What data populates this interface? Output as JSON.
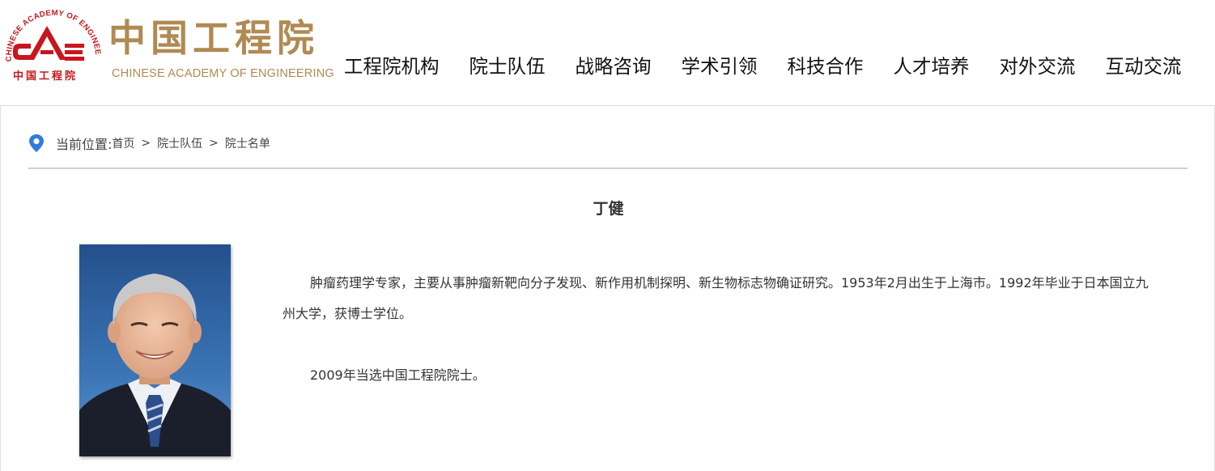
{
  "header": {
    "logo_cn": "中国工程院",
    "logo_en": "CHINESE ACADEMY OF ENGINEERING",
    "logo_ring_text": "CHINESE ACADEMY OF ENGINEERING",
    "logo_small_cn": "中国工程院",
    "logo_mark": "CAE",
    "brand_color": "#b08a52",
    "mark_color": "#c8161d"
  },
  "nav": {
    "items": [
      {
        "label": "工程院机构"
      },
      {
        "label": "院士队伍"
      },
      {
        "label": "战略咨询"
      },
      {
        "label": "学术引领"
      },
      {
        "label": "科技合作"
      },
      {
        "label": "人才培养"
      },
      {
        "label": "对外交流"
      },
      {
        "label": "互动交流"
      }
    ]
  },
  "breadcrumb": {
    "icon": "location-pin-icon",
    "label": "当前位置:",
    "items": [
      "首页",
      "院士队伍",
      "院士名单"
    ],
    "separator": ">"
  },
  "profile": {
    "name": "丁健",
    "bio_paragraphs": [
      "肿瘤药理学专家，主要从事肿瘤新靶向分子发现、新作用机制探明、新生物标志物确证研究。1953年2月出生于上海市。1992年毕业于日本国立九州大学，获博士学位。",
      "2009年当选中国工程院院士。"
    ]
  }
}
